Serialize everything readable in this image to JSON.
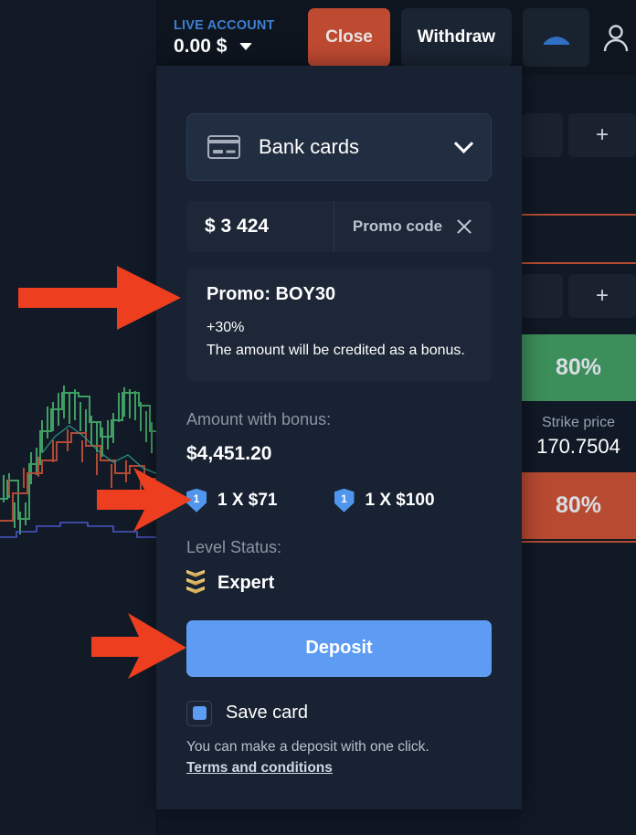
{
  "topbar": {
    "account_type": "LIVE ACCOUNT",
    "balance": "0.00 $",
    "dropdown_icon": "chevron-down-icon",
    "close_label": "Close",
    "withdraw_label": "Withdraw",
    "tool_icon": "arc-indicator-icon",
    "profile_icon": "user-icon"
  },
  "right_panel": {
    "add_icon": "plus-icon",
    "payout_up": "80%",
    "payout_down": "80%",
    "strike_label": "Strike price",
    "strike_value": "170.7504"
  },
  "modal": {
    "method": {
      "icon": "bank-card-icon",
      "label": "Bank cards",
      "chevron": "chevron-down-icon"
    },
    "amount_value": "$  3 424",
    "promo_field_label": "Promo code",
    "promo_clear_icon": "close-x-icon",
    "promo": {
      "title": "Promo: BOY30",
      "percent": "+30%",
      "description": "The amount will be credited as a bonus."
    },
    "bonus_label": "Amount with bonus:",
    "bonus_value": "$4,451.20",
    "badges": [
      {
        "icon": "shield-badge-icon",
        "count": "1",
        "text": "1 X $71"
      },
      {
        "icon": "shield-badge-icon",
        "count": "1",
        "text": "1 X $100"
      }
    ],
    "level_label": "Level Status:",
    "level_icon": "rank-chevrons-icon",
    "level_value": "Expert",
    "deposit_label": "Deposit",
    "save_card_label": "Save card",
    "save_card_checked": true,
    "hint": "You can make a deposit with one click.",
    "terms_label": "Terms and conditions"
  },
  "annotations": {
    "arrow_color": "#ed3f1f",
    "arrows": [
      {
        "name": "arrow-to-promo",
        "target": "promo-card"
      },
      {
        "name": "arrow-to-badges",
        "target": "bonus-badges"
      },
      {
        "name": "arrow-to-deposit",
        "target": "deposit-button"
      }
    ]
  },
  "chart": {
    "name": "candlestick-chart",
    "colors": {
      "bullish": "#3f9e63",
      "bearish": "#b14a36",
      "indicator": "#4a56c8"
    }
  }
}
